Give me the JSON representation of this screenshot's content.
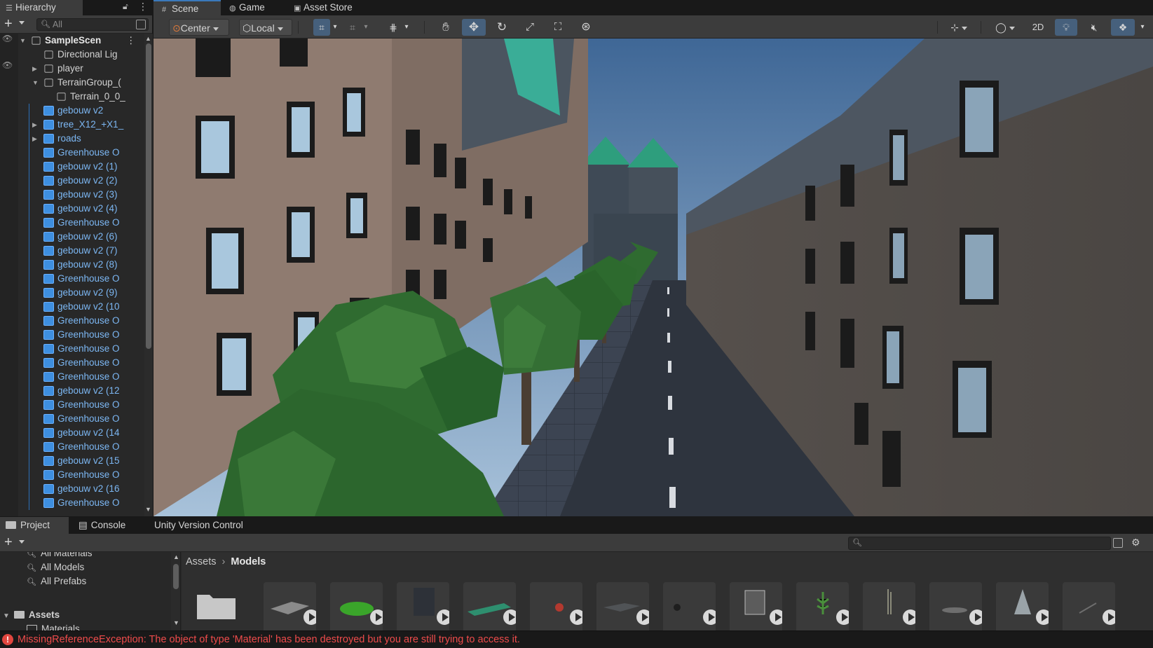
{
  "hierarchy": {
    "tab_label": "Hierarchy",
    "search_placeholder": "All",
    "rows": [
      {
        "label": "SampleScen",
        "kind": "scene",
        "depth": 0,
        "foldout": "open"
      },
      {
        "label": "Directional Lig",
        "kind": "object",
        "depth": 1,
        "foldout": "none"
      },
      {
        "label": "player",
        "kind": "object",
        "depth": 1,
        "foldout": "closed"
      },
      {
        "label": "TerrainGroup_(",
        "kind": "object",
        "depth": 1,
        "foldout": "open"
      },
      {
        "label": "Terrain_0_0_",
        "kind": "object",
        "depth": 2,
        "foldout": "none"
      },
      {
        "label": "gebouw v2",
        "kind": "prefab",
        "depth": 1,
        "foldout": "none"
      },
      {
        "label": "tree_X12_+X1_",
        "kind": "prefab",
        "depth": 1,
        "foldout": "closed"
      },
      {
        "label": "roads",
        "kind": "prefab",
        "depth": 1,
        "foldout": "closed"
      },
      {
        "label": "Greenhouse O",
        "kind": "prefab",
        "depth": 1,
        "foldout": "none"
      },
      {
        "label": "gebouw v2 (1)",
        "kind": "prefab",
        "depth": 1,
        "foldout": "none"
      },
      {
        "label": "gebouw v2 (2)",
        "kind": "prefab",
        "depth": 1,
        "foldout": "none"
      },
      {
        "label": "gebouw v2 (3)",
        "kind": "prefab",
        "depth": 1,
        "foldout": "none"
      },
      {
        "label": "gebouw v2 (4)",
        "kind": "prefab",
        "depth": 1,
        "foldout": "none"
      },
      {
        "label": "Greenhouse O",
        "kind": "prefab",
        "depth": 1,
        "foldout": "none"
      },
      {
        "label": "gebouw v2 (6)",
        "kind": "prefab",
        "depth": 1,
        "foldout": "none"
      },
      {
        "label": "gebouw v2 (7)",
        "kind": "prefab",
        "depth": 1,
        "foldout": "none"
      },
      {
        "label": "gebouw v2 (8)",
        "kind": "prefab",
        "depth": 1,
        "foldout": "none"
      },
      {
        "label": "Greenhouse O",
        "kind": "prefab",
        "depth": 1,
        "foldout": "none"
      },
      {
        "label": "gebouw v2 (9)",
        "kind": "prefab",
        "depth": 1,
        "foldout": "none"
      },
      {
        "label": "gebouw v2 (10",
        "kind": "prefab",
        "depth": 1,
        "foldout": "none"
      },
      {
        "label": "Greenhouse O",
        "kind": "prefab",
        "depth": 1,
        "foldout": "none"
      },
      {
        "label": "Greenhouse O",
        "kind": "prefab",
        "depth": 1,
        "foldout": "none"
      },
      {
        "label": "Greenhouse O",
        "kind": "prefab",
        "depth": 1,
        "foldout": "none"
      },
      {
        "label": "Greenhouse O",
        "kind": "prefab",
        "depth": 1,
        "foldout": "none"
      },
      {
        "label": "Greenhouse O",
        "kind": "prefab",
        "depth": 1,
        "foldout": "none"
      },
      {
        "label": "gebouw v2 (12",
        "kind": "prefab",
        "depth": 1,
        "foldout": "none"
      },
      {
        "label": "Greenhouse O",
        "kind": "prefab",
        "depth": 1,
        "foldout": "none"
      },
      {
        "label": "Greenhouse O",
        "kind": "prefab",
        "depth": 1,
        "foldout": "none"
      },
      {
        "label": "gebouw v2 (14",
        "kind": "prefab",
        "depth": 1,
        "foldout": "none"
      },
      {
        "label": "Greenhouse O",
        "kind": "prefab",
        "depth": 1,
        "foldout": "none"
      },
      {
        "label": "gebouw v2 (15",
        "kind": "prefab",
        "depth": 1,
        "foldout": "none"
      },
      {
        "label": "Greenhouse O",
        "kind": "prefab",
        "depth": 1,
        "foldout": "none"
      },
      {
        "label": "gebouw v2 (16",
        "kind": "prefab",
        "depth": 1,
        "foldout": "none"
      },
      {
        "label": "Greenhouse O",
        "kind": "prefab",
        "depth": 1,
        "foldout": "none"
      }
    ]
  },
  "scene_tabs": [
    {
      "label": "Scene",
      "icon": "grid-icon",
      "active": true
    },
    {
      "label": "Game",
      "icon": "gamepad-icon",
      "active": false
    },
    {
      "label": "Asset Store",
      "icon": "shopping-bag-icon",
      "active": false
    }
  ],
  "scene_toolbar": {
    "pivot_label": "Center",
    "space_label": "Local",
    "mode_2d_label": "2D"
  },
  "project": {
    "tabs": [
      {
        "label": "Project",
        "icon": "folder-icon"
      },
      {
        "label": "Console",
        "icon": "console-icon"
      },
      {
        "label": "Unity Version Control",
        "icon": ""
      }
    ],
    "favorites": [
      "All Materials",
      "All Models",
      "All Prefabs"
    ],
    "root_folder": "Assets",
    "subfolder": "Materials",
    "breadcrumb": {
      "root": "Assets",
      "current": "Models"
    },
    "search_value": ""
  },
  "status": {
    "error_text": "MissingReferenceException: The object of type 'Material' has been destroyed but you are still trying to access it."
  },
  "colors": {
    "accent": "#3a79bb",
    "prefab_text": "#7cb7f3",
    "error": "#ee4b4b",
    "sky": "#5f86b0",
    "foliage": "#2f6b30"
  }
}
